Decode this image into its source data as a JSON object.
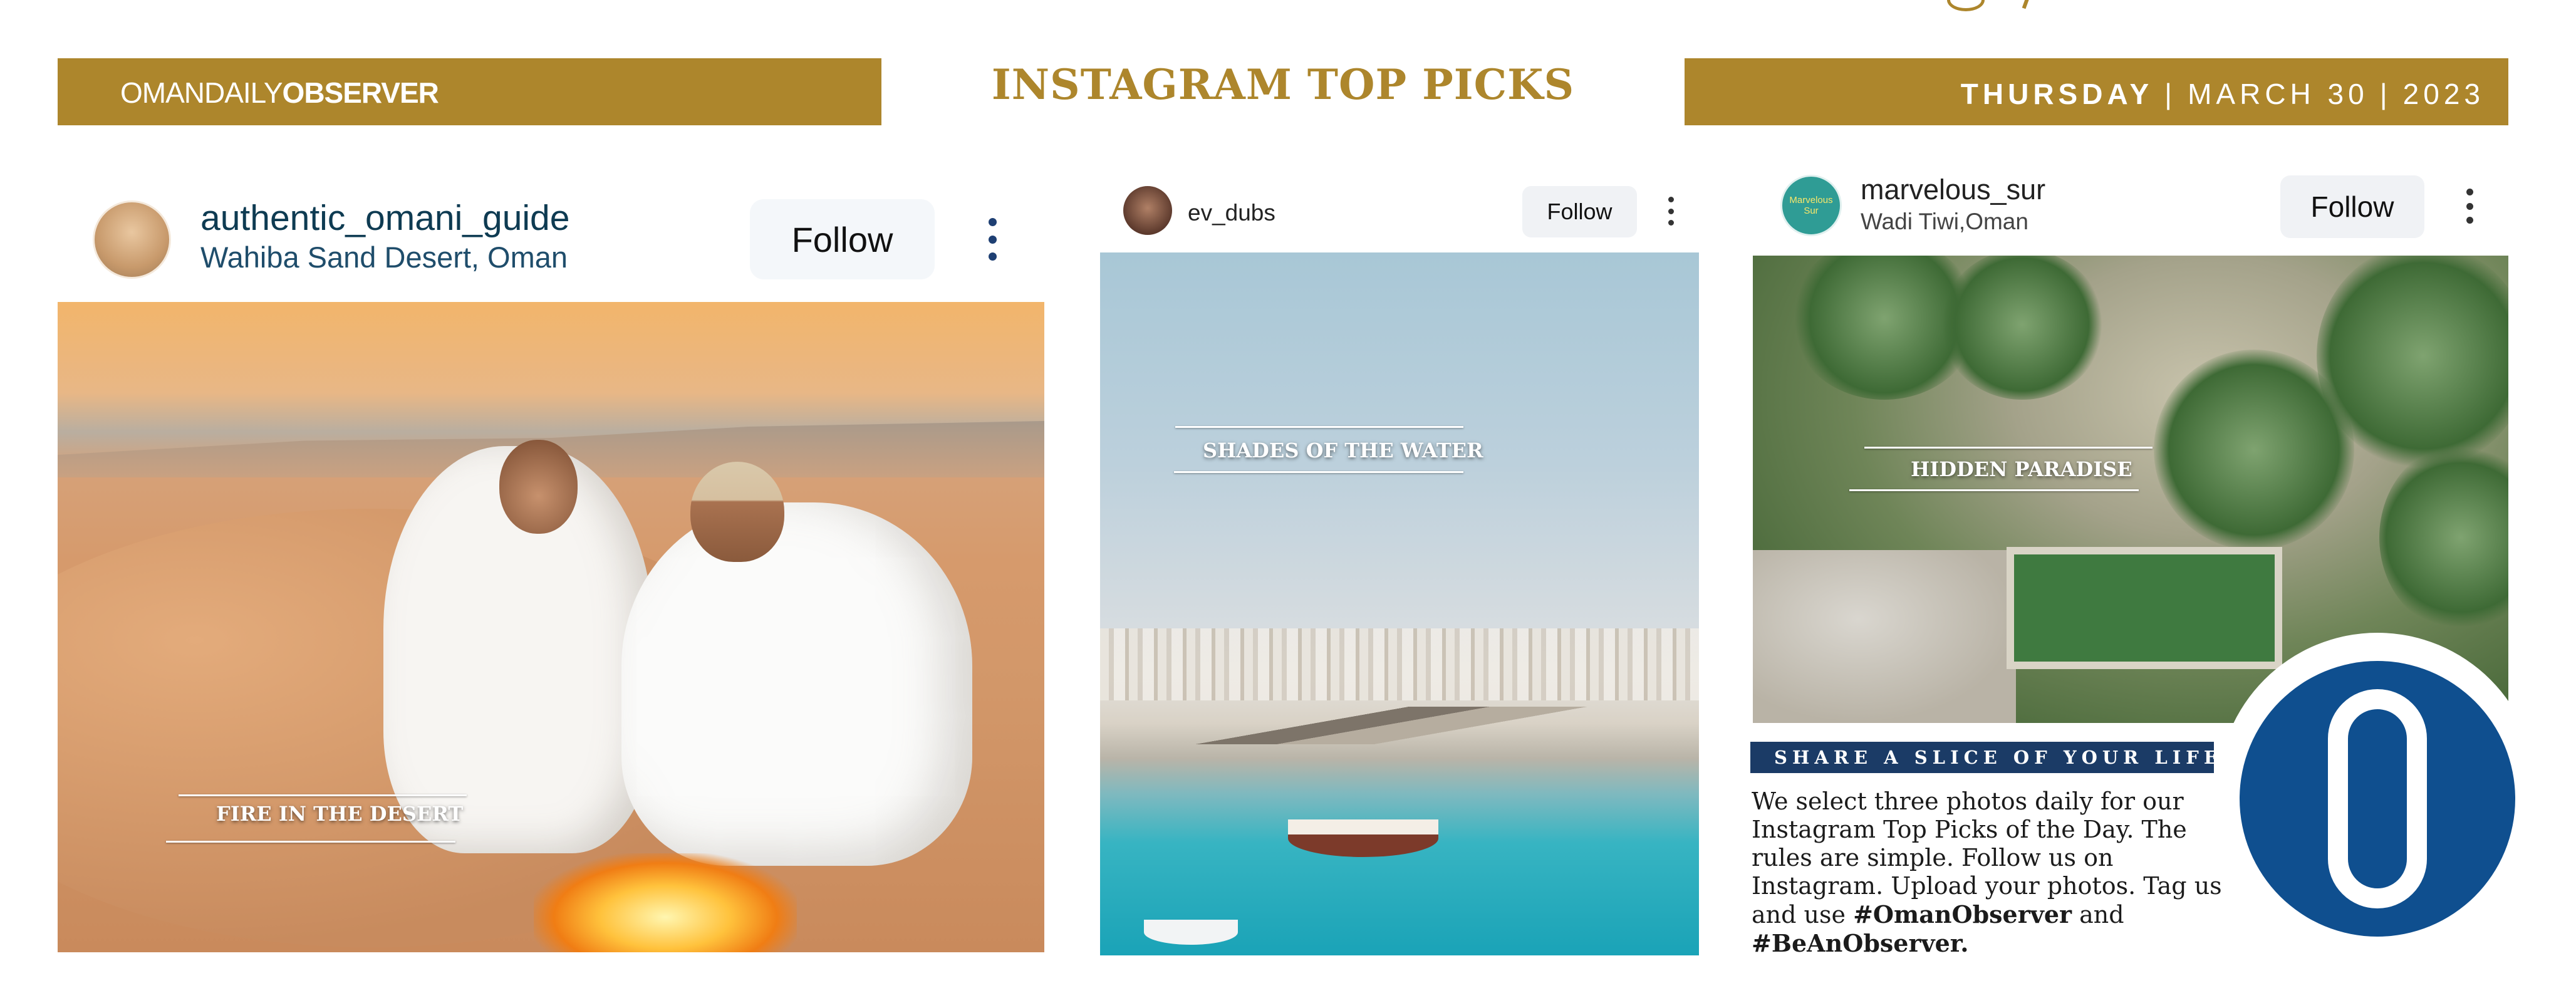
{
  "header": {
    "brand_light": "OMANDAILY",
    "brand_bold": "OBSERVER",
    "title": "INSTAGRAM TOP PICKS",
    "day": "THURSDAY",
    "month_day": "MARCH 30",
    "year": "2023",
    "accent_color": "#ad862c"
  },
  "posts": [
    {
      "username": "authentic_omani_guide",
      "location": "Wahiba Sand Desert, Oman",
      "follow_label": "Follow",
      "caption": "FIRE IN THE DESERT"
    },
    {
      "username": "ev_dubs",
      "follow_label": "Follow",
      "caption": "SHADES OF THE WATER"
    },
    {
      "username": "marvelous_sur",
      "location": "Wadi Tiwi,Oman",
      "follow_label": "Follow",
      "avatar_text": "Marvelous Sur",
      "caption": "HIDDEN PARADISE"
    }
  ],
  "share": {
    "heading": "SHARE A SLICE OF YOUR LIFE",
    "body": "We select three photos daily for our Instagram Top Picks of the Day. The rules are simple. Follow us on Instagram. Upload your photos. Tag us and use ",
    "hashtag1": "#OmanObserver",
    "and_text": " and ",
    "hashtag2": "#BeAnObserver."
  },
  "icons": {
    "more": "more-vertical-icon",
    "logo": "oman-observer-logo"
  }
}
